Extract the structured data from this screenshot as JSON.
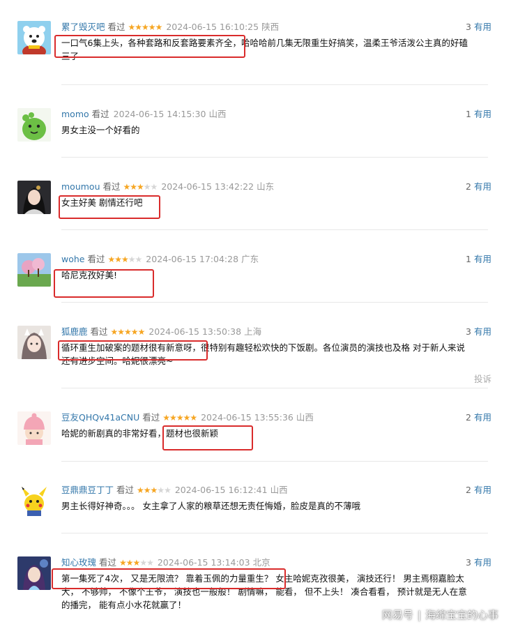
{
  "comments": [
    {
      "name": "累了毁灭吧",
      "seen": "看过",
      "rating": 5,
      "time": "2024-06-15 16:10:25",
      "location": "陕西",
      "votes": "3",
      "useful": "有用",
      "content": "一口气6集上头，各种套路和反套路要素齐全，哈哈哈前几集无限重生好搞笑，温柔王爷活泼公主真的好磕",
      "content2": "三了",
      "avatar": "polar-bear-avatar"
    },
    {
      "name": "momo",
      "seen": "看过",
      "rating": 0,
      "time": "2024-06-15 14:15:30",
      "location": "山西",
      "votes": "1",
      "useful": "有用",
      "content": "男女主没一个好看的",
      "avatar": "green-dino-avatar"
    },
    {
      "name": "moumou",
      "seen": "看过",
      "rating": 3,
      "time": "2024-06-15 13:42:22",
      "location": "山东",
      "votes": "2",
      "useful": "有用",
      "content": "女主好美 剧情还行吧",
      "avatar": "costume-portrait-avatar"
    },
    {
      "name": "wohe",
      "seen": "看过",
      "rating": 3,
      "time": "2024-06-15 17:04:28",
      "location": "广东",
      "votes": "1",
      "useful": "有用",
      "content": "哈尼克孜好美!",
      "avatar": "landscape-avatar"
    },
    {
      "name": "狐鹿鹿",
      "seen": "看过",
      "rating": 5,
      "time": "2024-06-15 13:50:38",
      "location": "上海",
      "votes": "3",
      "useful": "有用",
      "content": "循环重生加破案的题材很有新意呀，很特别有趣轻松欢快的下饭剧。各位演员的演技也及格 对于新人来说",
      "content2": "还有进步空间。哈妮很漂亮~",
      "report": "投诉",
      "avatar": "fox-girl-avatar"
    },
    {
      "name": "豆友QHQv41aCNU",
      "seen": "看过",
      "rating": 5,
      "time": "2024-06-15 13:55:36",
      "location": "山西",
      "votes": "2",
      "useful": "有用",
      "content": "哈妮的新剧真的非常好看，题材也很新颖",
      "avatar": "pink-hat-avatar"
    },
    {
      "name": "豆鼎鼎豆丁丁",
      "seen": "看过",
      "rating": 3,
      "time": "2024-06-15 16:12:41",
      "location": "山西",
      "votes": "2",
      "useful": "有用",
      "content": "男主长得好神奇。。。 女主拿了人家的粮草还想无责任悔婚，脸皮是真的不薄哦",
      "avatar": "pikachu-avatar"
    },
    {
      "name": "知心玫瑰",
      "seen": "看过",
      "rating": 3,
      "time": "2024-06-15 13:14:03",
      "location": "北京",
      "votes": "3",
      "useful": "有用",
      "content": "第一集死了4次， 又是无限流？ 靠着玉佩的力量重生？ 女主哈妮克孜很美， 演技还行！ 男主焉栩嘉脸太",
      "content2": "大， 不够帅， 不像个王爷， 演技也一般般！ 剧情嘛， 能看， 但不上头！ 凑合看看， 预计就是无人在意",
      "content3": "的播完， 能有点小水花就赢了！",
      "avatar": "game-character-avatar"
    }
  ],
  "watermark": {
    "brand": "网易号",
    "author": "海绵宝宝的心事"
  },
  "colors": {
    "link": "#3377aa",
    "star": "#f6a623",
    "highlight": "#d92b2b"
  }
}
